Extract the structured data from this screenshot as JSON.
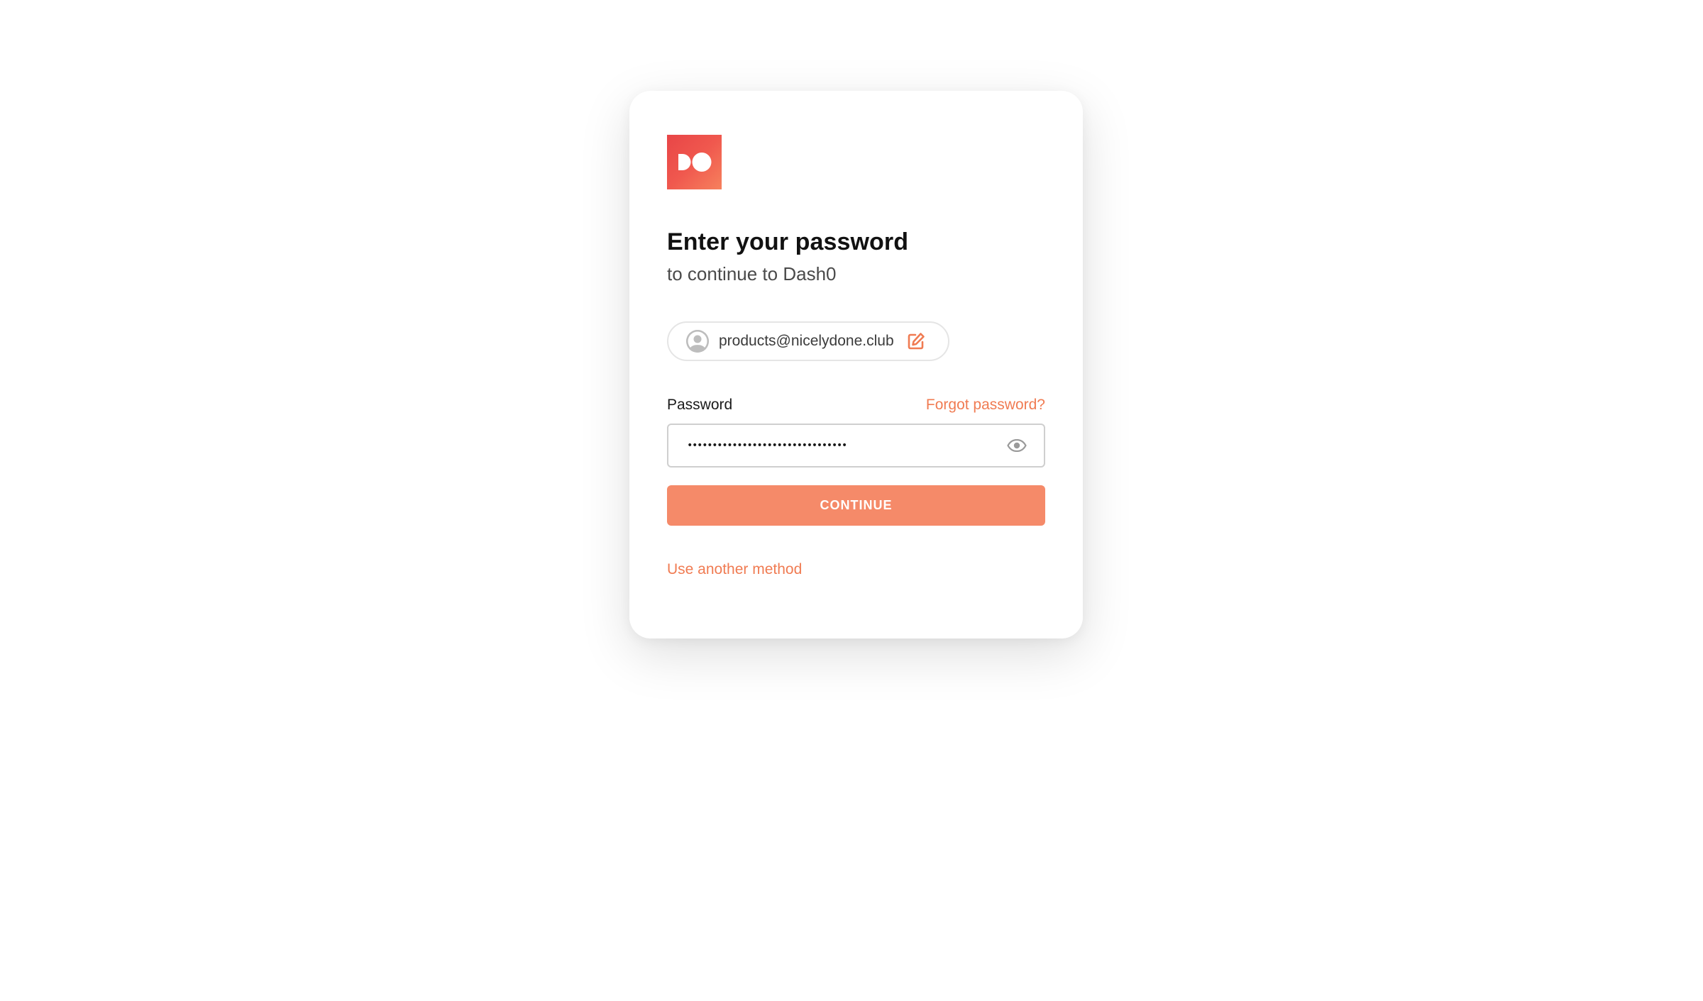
{
  "brand": {
    "logo_icon": "dash0-logo-icon",
    "accent_color": "#f07b52",
    "button_color": "#f58a69",
    "logo_gradient": [
      "#e84547",
      "#f6815d"
    ]
  },
  "header": {
    "title": "Enter your password",
    "subtitle": "to continue to Dash0"
  },
  "identity": {
    "avatar_icon": "user-avatar-icon",
    "email": "products@nicelydone.club",
    "edit_icon": "edit-icon"
  },
  "password": {
    "label": "Password",
    "forgot_label": "Forgot password?",
    "value": "••••••••••••••••••••••••••••••••",
    "toggle_icon": "eye-icon"
  },
  "actions": {
    "continue_label": "CONTINUE",
    "another_method_label": "Use another method"
  }
}
